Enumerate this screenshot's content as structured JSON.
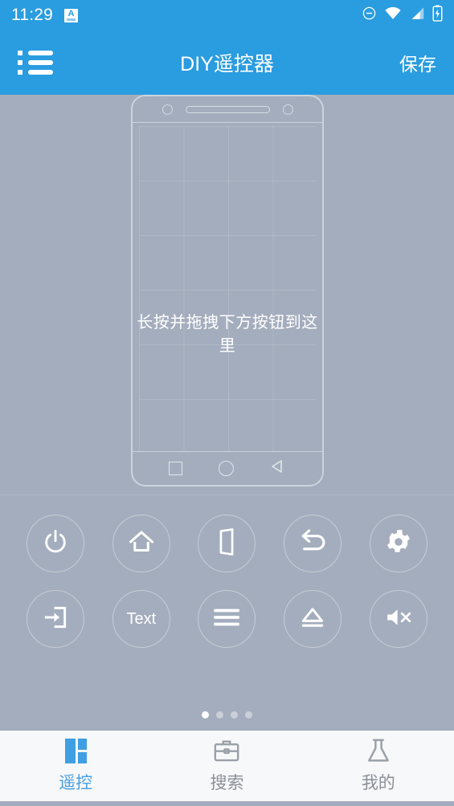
{
  "status_bar": {
    "time": "11:29",
    "input_badge": "A",
    "icons": [
      "dnd-icon",
      "wifi-icon",
      "signal-icon",
      "battery-charging-icon"
    ]
  },
  "app_bar": {
    "menu_icon": "list-menu-icon",
    "title": "DIY遥控器",
    "save_label": "保存"
  },
  "preview": {
    "drop_hint": "长按并拖拽下方按钮到这里",
    "phone_nav": [
      "recents-square-icon",
      "home-circle-icon",
      "back-triangle-icon"
    ]
  },
  "palette": {
    "rows": [
      [
        {
          "name": "power-button",
          "icon": "power-icon",
          "label": ""
        },
        {
          "name": "home-button",
          "icon": "home-icon",
          "label": ""
        },
        {
          "name": "exit-button",
          "icon": "door-icon",
          "label": ""
        },
        {
          "name": "back-button",
          "icon": "back-arrow-icon",
          "label": ""
        },
        {
          "name": "settings-button",
          "icon": "gear-icon",
          "label": ""
        }
      ],
      [
        {
          "name": "input-source-button",
          "icon": "input-icon",
          "label": ""
        },
        {
          "name": "text-button",
          "icon": "text-icon",
          "label": "Text"
        },
        {
          "name": "menu-button",
          "icon": "hamburger-icon",
          "label": ""
        },
        {
          "name": "eject-button",
          "icon": "eject-icon",
          "label": ""
        },
        {
          "name": "mute-button",
          "icon": "mute-icon",
          "label": ""
        }
      ]
    ],
    "page_count": 4,
    "active_page": 1
  },
  "tab_bar": {
    "tabs": [
      {
        "label": "遥控",
        "icon": "dashboard-icon",
        "active": true
      },
      {
        "label": "搜索",
        "icon": "briefcase-icon",
        "active": false
      },
      {
        "label": "我的",
        "icon": "flask-icon",
        "active": false
      }
    ]
  },
  "colors": {
    "accent": "#2a9ce0",
    "background": "#a4adbd",
    "tab_active": "#4a9fe0",
    "tab_inactive": "#8a8f98"
  }
}
